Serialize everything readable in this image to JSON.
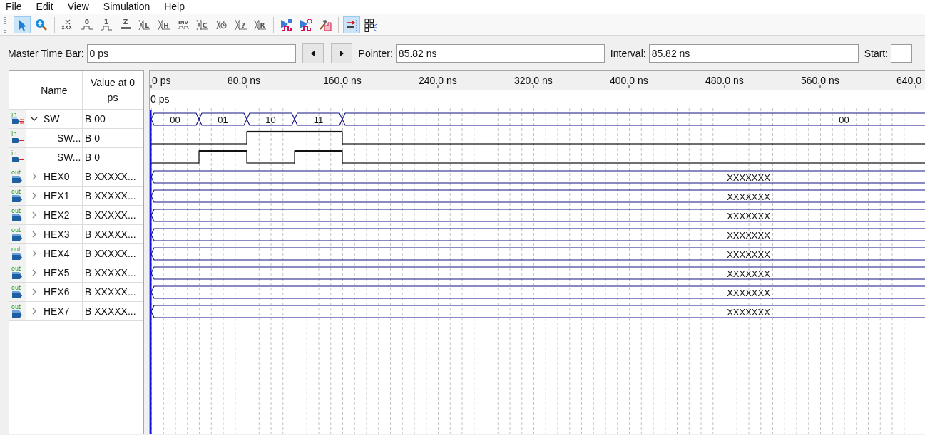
{
  "menu": [
    "File",
    "Edit",
    "View",
    "Simulation",
    "Help"
  ],
  "toolbar": {
    "groups": [
      [
        {
          "kind": "pointer",
          "selected": true
        },
        {
          "kind": "zoom",
          "selected": false
        }
      ],
      [
        {
          "kind": "unknown",
          "selected": false
        },
        {
          "kind": "low",
          "label": "0",
          "selected": false
        },
        {
          "kind": "high",
          "label": "1",
          "selected": false
        },
        {
          "kind": "bar",
          "label": "Z",
          "selected": false
        },
        {
          "kind": "value",
          "label": "L",
          "selected": false
        },
        {
          "kind": "value",
          "label": "H",
          "selected": false
        },
        {
          "kind": "wave",
          "label": "INV",
          "selected": false
        },
        {
          "kind": "value",
          "label": "C",
          "selected": false
        },
        {
          "kind": "clock",
          "selected": false
        },
        {
          "kind": "value",
          "label": "?",
          "selected": false
        },
        {
          "kind": "value",
          "label": "R",
          "selected": false
        }
      ],
      [
        {
          "kind": "run",
          "selected": false
        },
        {
          "kind": "run-timed",
          "selected": false
        },
        {
          "kind": "hammer",
          "selected": false
        }
      ],
      [
        {
          "kind": "snap",
          "selected": true
        },
        {
          "kind": "grid",
          "selected": false
        }
      ]
    ]
  },
  "time_bar": {
    "master": {
      "label": "Master Time Bar:",
      "value": "0 ps"
    },
    "pointer": {
      "label": "Pointer:",
      "value": "85.82 ns"
    },
    "interval": {
      "label": "Interval:",
      "value": "85.82 ns"
    },
    "start": {
      "label": "Start:"
    }
  },
  "signal_list": {
    "columns": [
      "Name",
      "Value at 0 ps"
    ]
  },
  "waveform": {
    "ruler": [
      "0 ps",
      "80.0 ns",
      "160.0 ns",
      "240.0 ns",
      "320.0 ns",
      "400.0 ns",
      "480.0 ns",
      "560.0 ns",
      "640.0"
    ],
    "cursor_label": "0 ps"
  },
  "signals": [
    {
      "name": "SW",
      "value": "B 00",
      "direction": "in",
      "kind": "bus",
      "expanded": true,
      "segments": [
        "00",
        "01",
        "10",
        "11",
        "00"
      ],
      "children": [
        {
          "name": "SW...",
          "value": "B 0",
          "direction": "in",
          "kind": "bit",
          "pulses": [
            {
              "high": false
            },
            {
              "high": false
            },
            {
              "high": true
            },
            {
              "high": true
            },
            {
              "high": false
            }
          ]
        },
        {
          "name": "SW...",
          "value": "B 0",
          "direction": "in",
          "kind": "bit",
          "pulses": [
            {
              "high": false
            },
            {
              "high": true
            },
            {
              "high": false
            },
            {
              "high": true
            },
            {
              "high": false
            }
          ]
        }
      ]
    },
    {
      "name": "HEX0",
      "value": "B XXXXX...",
      "direction": "out",
      "kind": "bus",
      "expanded": false,
      "segments": [
        "XXXXXXX"
      ]
    },
    {
      "name": "HEX1",
      "value": "B XXXXX...",
      "direction": "out",
      "kind": "bus",
      "expanded": false,
      "segments": [
        "XXXXXXX"
      ]
    },
    {
      "name": "HEX2",
      "value": "B XXXXX...",
      "direction": "out",
      "kind": "bus",
      "expanded": false,
      "segments": [
        "XXXXXXX"
      ]
    },
    {
      "name": "HEX3",
      "value": "B XXXXX...",
      "direction": "out",
      "kind": "bus",
      "expanded": false,
      "segments": [
        "XXXXXXX"
      ]
    },
    {
      "name": "HEX4",
      "value": "B XXXXX...",
      "direction": "out",
      "kind": "bus",
      "expanded": false,
      "segments": [
        "XXXXXXX"
      ]
    },
    {
      "name": "HEX5",
      "value": "B XXXXX...",
      "direction": "out",
      "kind": "bus",
      "expanded": false,
      "segments": [
        "XXXXXXX"
      ]
    },
    {
      "name": "HEX6",
      "value": "B XXXXX...",
      "direction": "out",
      "kind": "bus",
      "expanded": false,
      "segments": [
        "XXXXXXX"
      ]
    },
    {
      "name": "HEX7",
      "value": "B XXXXX...",
      "direction": "out",
      "kind": "bus",
      "expanded": false,
      "segments": [
        "XXXXXXX"
      ]
    }
  ]
}
